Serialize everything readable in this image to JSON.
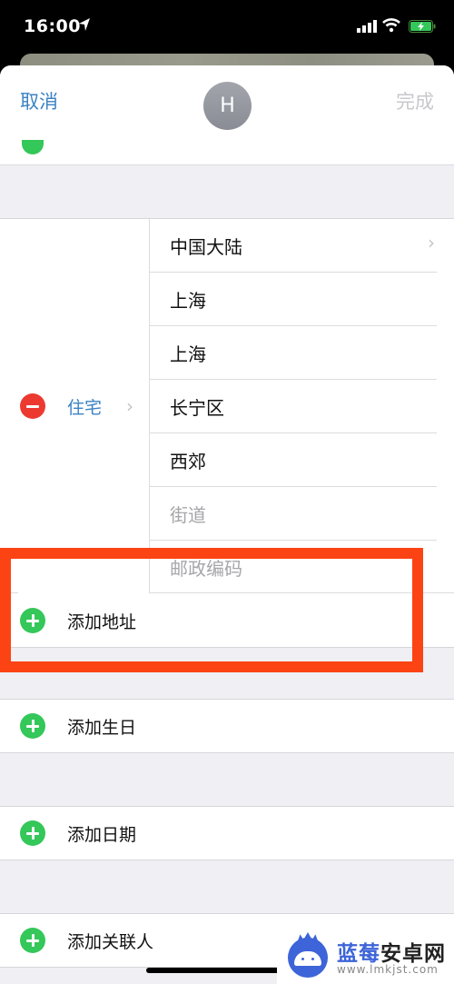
{
  "status_bar": {
    "time": "16:00",
    "icons": [
      "location-arrow-icon",
      "cellular-signal-icon",
      "wifi-icon",
      "battery-charging-icon"
    ]
  },
  "nav": {
    "cancel_label": "取消",
    "done_label": "完成",
    "avatar_initial": "H"
  },
  "address": {
    "label": "住宅",
    "fields": [
      {
        "name": "country",
        "value": "中国大陆",
        "placeholder": "",
        "has_chevron": true
      },
      {
        "name": "province",
        "value": "上海",
        "placeholder": ""
      },
      {
        "name": "city",
        "value": "上海",
        "placeholder": ""
      },
      {
        "name": "district",
        "value": "长宁区",
        "placeholder": ""
      },
      {
        "name": "street-area",
        "value": "西郊",
        "placeholder": ""
      },
      {
        "name": "street",
        "value": "",
        "placeholder": "街道"
      },
      {
        "name": "postal-code",
        "value": "",
        "placeholder": "邮政编码"
      }
    ],
    "add_label": "添加地址"
  },
  "sections": [
    {
      "label": "添加生日"
    },
    {
      "label": "添加日期"
    },
    {
      "label": "添加关联人"
    }
  ],
  "annotation": {
    "color": "#fc4314"
  },
  "watermark": {
    "title_blue": "蓝莓",
    "title_dark": "安卓网",
    "url": "www.lmkjst.com"
  },
  "colors": {
    "accent": "#3b82c4",
    "add_green": "#34c759",
    "delete_red": "#ec3a31"
  }
}
